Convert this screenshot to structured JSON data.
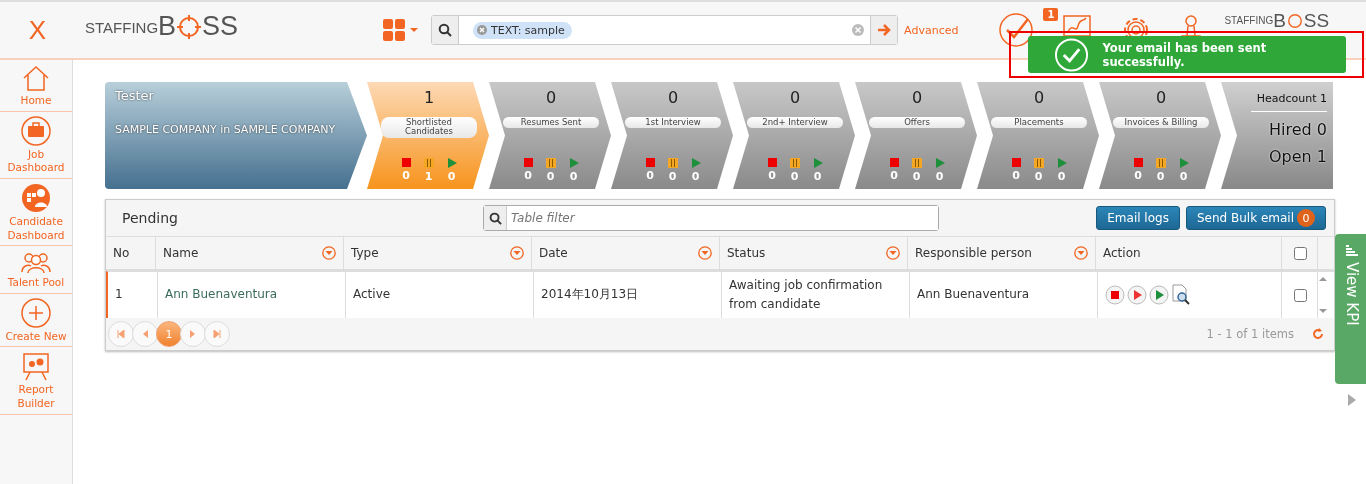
{
  "header": {
    "close_glyph": "X",
    "logo": {
      "left": "STAFFING",
      "boss_start": "B",
      "boss_end": "SS"
    },
    "search": {
      "chip": "TEXT: sample",
      "advanced": "Advanced"
    },
    "nav": [
      {
        "kind": "taskboard",
        "badge": "1"
      },
      {
        "kind": "analytics"
      },
      {
        "kind": "settings"
      },
      {
        "kind": "account"
      }
    ],
    "brand": {
      "left": "STAFFING",
      "boss_start": "B",
      "boss_end": "SS"
    }
  },
  "toast": {
    "message": "Your email has been sent successfully."
  },
  "sidebar": [
    {
      "kind": "home",
      "label": "Home"
    },
    {
      "kind": "job",
      "label": "Job Dashboard"
    },
    {
      "kind": "candidate",
      "label": "Candidate Dashboard"
    },
    {
      "kind": "talent",
      "label": "Talent Pool"
    },
    {
      "kind": "create",
      "label": "Create New"
    },
    {
      "kind": "report",
      "label": "Report Builder"
    }
  ],
  "job": {
    "title": "Tester",
    "company": "SAMPLE COMPANY in SAMPLE COMPANY"
  },
  "stages": [
    {
      "count": "1",
      "label": "Shortlisted Candidates",
      "selected": true,
      "stopped": "0",
      "paused": "1",
      "active": "0"
    },
    {
      "count": "0",
      "label": "Resumes Sent",
      "selected": false,
      "stopped": "0",
      "paused": "0",
      "active": "0"
    },
    {
      "count": "0",
      "label": "1st Interview",
      "selected": false,
      "stopped": "0",
      "paused": "0",
      "active": "0"
    },
    {
      "count": "0",
      "label": "2nd+ Interview",
      "selected": false,
      "stopped": "0",
      "paused": "0",
      "active": "0"
    },
    {
      "count": "0",
      "label": "Offers",
      "selected": false,
      "stopped": "0",
      "paused": "0",
      "active": "0"
    },
    {
      "count": "0",
      "label": "Placements",
      "selected": false,
      "stopped": "0",
      "paused": "0",
      "active": "0"
    },
    {
      "count": "0",
      "label": "Invoices & Billing",
      "selected": false,
      "stopped": "0",
      "paused": "0",
      "active": "0"
    }
  ],
  "summary": {
    "headcount": "Headcount 1",
    "hired": "Hired 0",
    "open": "Open 1"
  },
  "panel": {
    "title": "Pending",
    "filter_placeholder": "Table filter",
    "email_logs": "Email logs",
    "bulk_email": "Send Bulk email",
    "bulk_count": "0"
  },
  "table": {
    "columns": [
      {
        "label": "No",
        "filter": false
      },
      {
        "label": "Name",
        "filter": true
      },
      {
        "label": "Type",
        "filter": true
      },
      {
        "label": "Date",
        "filter": true
      },
      {
        "label": "Status",
        "filter": true
      },
      {
        "label": "Responsible person",
        "filter": true
      },
      {
        "label": "Action",
        "filter": false
      }
    ],
    "select_all_checked": false,
    "rows": [
      {
        "no": "1",
        "name": "Ann Buenaventura",
        "type": "Active",
        "date": "2014年10月13日",
        "status": "Awaiting job confirmation from candidate",
        "responsible": "Ann Buenaventura",
        "checked": false
      }
    ]
  },
  "pager": {
    "pages": [
      {
        "label": "1",
        "selected": true
      }
    ],
    "summary": "1 - 1 of 1 items"
  },
  "kpi_tab": {
    "label": "View KPI"
  }
}
